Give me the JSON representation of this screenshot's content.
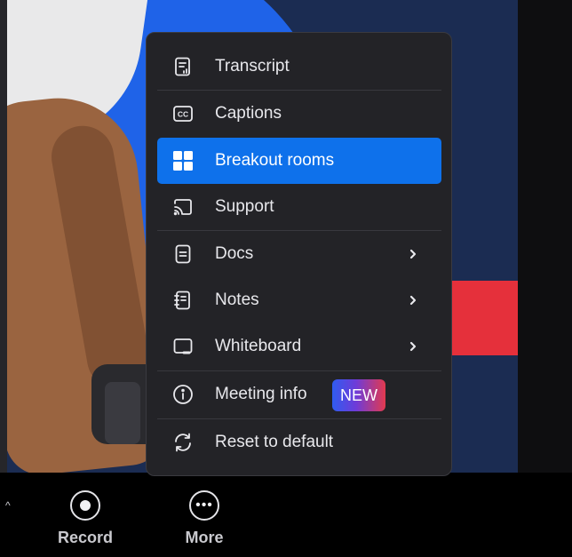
{
  "menu": {
    "items": [
      {
        "label": "Transcript",
        "icon": "transcript-icon"
      },
      {
        "label": "Captions",
        "icon": "captions-icon"
      },
      {
        "label": "Breakout rooms",
        "icon": "breakout-rooms-icon",
        "active": true
      },
      {
        "label": "Support",
        "icon": "support-icon"
      },
      {
        "label": "Docs",
        "icon": "docs-icon",
        "submenu": true
      },
      {
        "label": "Notes",
        "icon": "notes-icon",
        "submenu": true
      },
      {
        "label": "Whiteboard",
        "icon": "whiteboard-icon",
        "submenu": true
      },
      {
        "label": "Meeting info",
        "icon": "info-icon",
        "badge": "NEW"
      },
      {
        "label": "Reset to default",
        "icon": "reset-icon"
      }
    ],
    "captions_icon_text": "CC"
  },
  "toolbar": {
    "record_label": "Record",
    "more_label": "More",
    "caret": "^",
    "more_dots": "•••"
  },
  "colors": {
    "accent": "#0e71eb",
    "menu_bg": "#232327",
    "badge_from": "#2f5cf0",
    "badge_to": "#e23a4f"
  }
}
